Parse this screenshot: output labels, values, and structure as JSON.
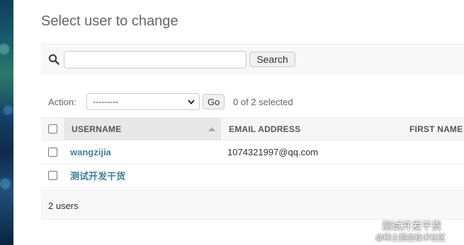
{
  "page": {
    "title": "Select user to change"
  },
  "search": {
    "value": "",
    "placeholder": "",
    "button_label": "Search"
  },
  "actions": {
    "label": "Action:",
    "select_value": "---------",
    "go_label": "Go",
    "selected_text": "0 of 2 selected"
  },
  "table": {
    "columns": [
      "USERNAME",
      "EMAIL ADDRESS",
      "FIRST NAME"
    ],
    "sorted_column": "USERNAME",
    "rows": [
      {
        "username": "wangzijia",
        "email": "1074321997@qq.com",
        "first_name": ""
      },
      {
        "username": "测试开发干货",
        "email": "",
        "first_name": ""
      }
    ]
  },
  "footer": {
    "count_text": "2 users"
  },
  "watermark": {
    "title": "测试开发干货",
    "subtitle": "@稀土掘金技术社区"
  },
  "colors": {
    "link": "#447e9b",
    "header_bg": "#f6f6f6",
    "toolbar_bg": "#f8f8f8"
  }
}
